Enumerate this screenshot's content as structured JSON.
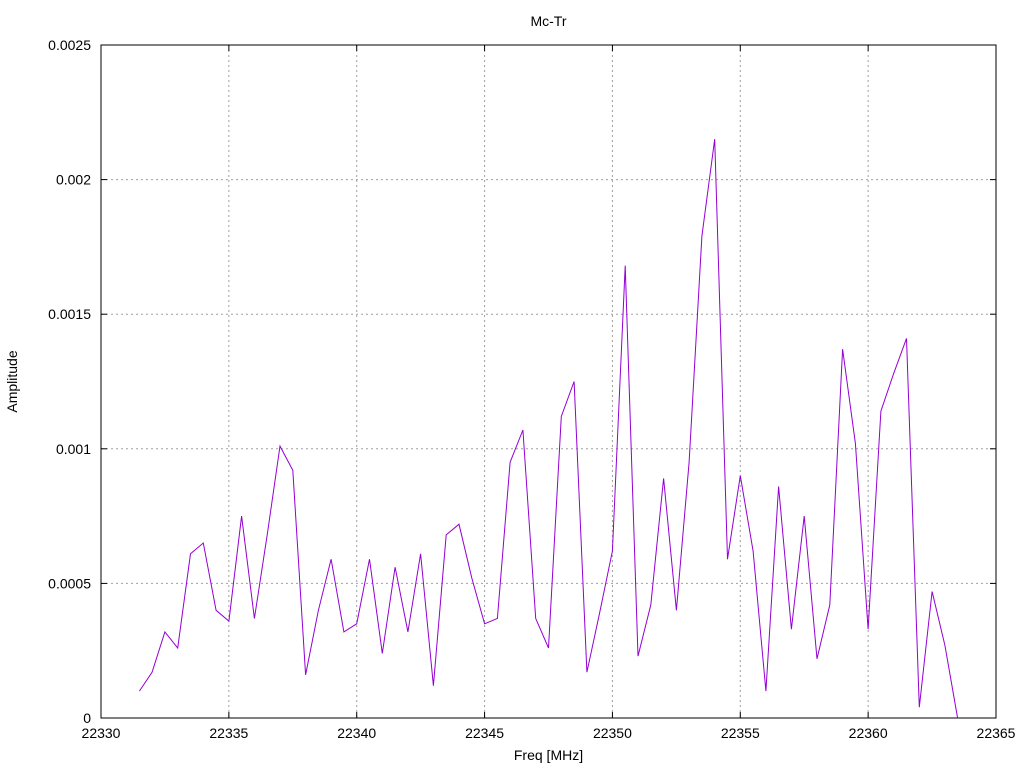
{
  "chart_data": {
    "type": "line",
    "title": "Mc-Tr",
    "xlabel": "Freq [MHz]",
    "ylabel": "Amplitude",
    "xlim": [
      22330,
      22365
    ],
    "ylim": [
      0,
      0.0025
    ],
    "xticks": [
      "22330",
      "22335",
      "22340",
      "22345",
      "22350",
      "22355",
      "22360",
      "22365"
    ],
    "yticks": [
      "0",
      "0.0005",
      "0.001",
      "0.0015",
      "0.002",
      "0.0025"
    ],
    "grid": true,
    "legend": "none",
    "color": "#9400d3",
    "series": [
      {
        "x": [
          22331.5,
          22332.0,
          22332.5,
          22333.0,
          22333.5,
          22334.0,
          22334.5,
          22335.0,
          22335.5,
          22336.0,
          22336.5,
          22337.0,
          22337.5,
          22338.0,
          22338.5,
          22339.0,
          22339.5,
          22340.0,
          22340.5,
          22341.0,
          22341.5,
          22342.0,
          22342.5,
          22343.0,
          22343.5,
          22344.0,
          22344.5,
          22345.0,
          22345.5,
          22346.0,
          22346.5,
          22347.0,
          22347.5,
          22348.0,
          22348.5,
          22349.0,
          22349.5,
          22350.0,
          22350.5,
          22351.0,
          22351.5,
          22352.0,
          22352.5,
          22353.0,
          22353.5,
          22354.0,
          22354.5,
          22355.0,
          22355.5,
          22356.0,
          22356.5,
          22357.0,
          22357.5,
          22358.0,
          22358.5,
          22359.0,
          22359.5,
          22360.0,
          22360.5,
          22361.0,
          22361.5,
          22362.0,
          22362.5,
          22363.0,
          22363.5
        ],
        "y": [
          0.0001,
          0.00017,
          0.00032,
          0.00026,
          0.00061,
          0.00065,
          0.0004,
          0.00036,
          0.00075,
          0.00037,
          0.00068,
          0.00101,
          0.00092,
          0.00016,
          0.0004,
          0.00059,
          0.00032,
          0.00035,
          0.00059,
          0.00024,
          0.00056,
          0.00032,
          0.00061,
          0.00012,
          0.00068,
          0.00072,
          0.00052,
          0.00035,
          0.00037,
          0.00095,
          0.00107,
          0.00037,
          0.00026,
          0.00112,
          0.00125,
          0.00017,
          0.00039,
          0.00062,
          0.00168,
          0.00023,
          0.00042,
          0.00089,
          0.0004,
          0.00095,
          0.00179,
          0.00215,
          0.00059,
          0.0009,
          0.00062,
          0.0001,
          0.00086,
          0.00033,
          0.00075,
          0.00022,
          0.00042,
          0.00137,
          0.00102,
          0.00033,
          0.00114,
          0.00128,
          0.00141,
          4e-05,
          0.00047,
          0.00027,
          0.0
        ]
      }
    ]
  }
}
